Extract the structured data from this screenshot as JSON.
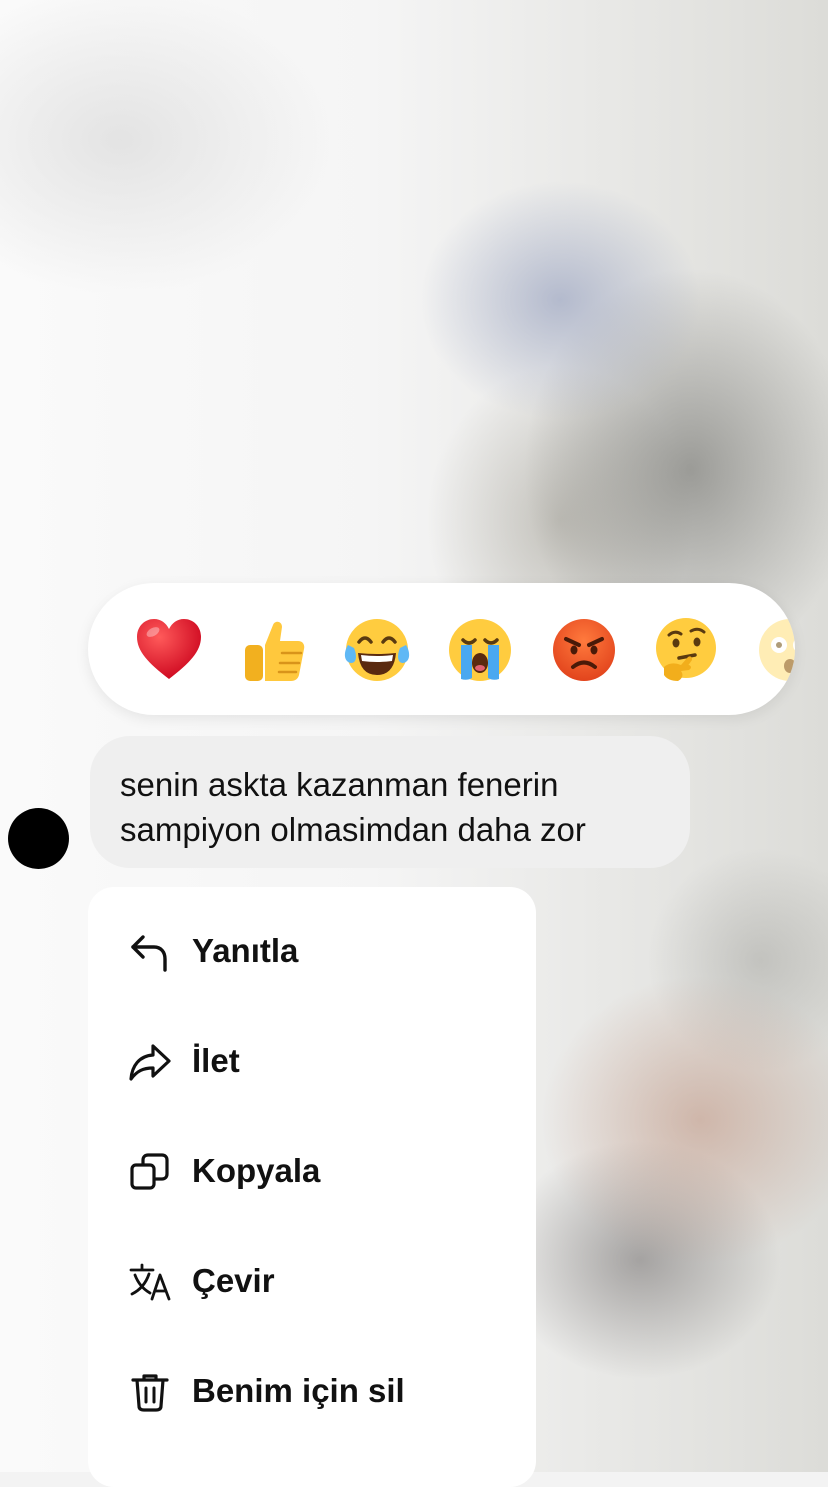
{
  "reactions": [
    {
      "name": "heart",
      "icon": "red-heart-emoji"
    },
    {
      "name": "thumbs-up",
      "icon": "thumbs-up-emoji"
    },
    {
      "name": "tears-of-joy",
      "icon": "face-with-tears-of-joy-emoji"
    },
    {
      "name": "crying",
      "icon": "loudly-crying-face-emoji"
    },
    {
      "name": "angry",
      "icon": "angry-face-emoji"
    },
    {
      "name": "thinking",
      "icon": "thinking-face-emoji"
    },
    {
      "name": "astonished",
      "icon": "astonished-face-emoji"
    }
  ],
  "message": {
    "line1": "senin askta kazanman fenerin",
    "line2": "sampiyon olmasimdan daha zor"
  },
  "menu": {
    "items": [
      {
        "label": "Yanıtla",
        "icon": "reply-arrow-icon"
      },
      {
        "label": "İlet",
        "icon": "forward-arrow-icon"
      },
      {
        "label": "Kopyala",
        "icon": "copy-icon"
      },
      {
        "label": "Çevir",
        "icon": "translate-icon"
      },
      {
        "label": "Benim için sil",
        "icon": "trash-icon"
      }
    ]
  },
  "colors": {
    "avatar": "#000000",
    "bubble": "#efefef",
    "text": "#111111",
    "surface": "#ffffff"
  }
}
